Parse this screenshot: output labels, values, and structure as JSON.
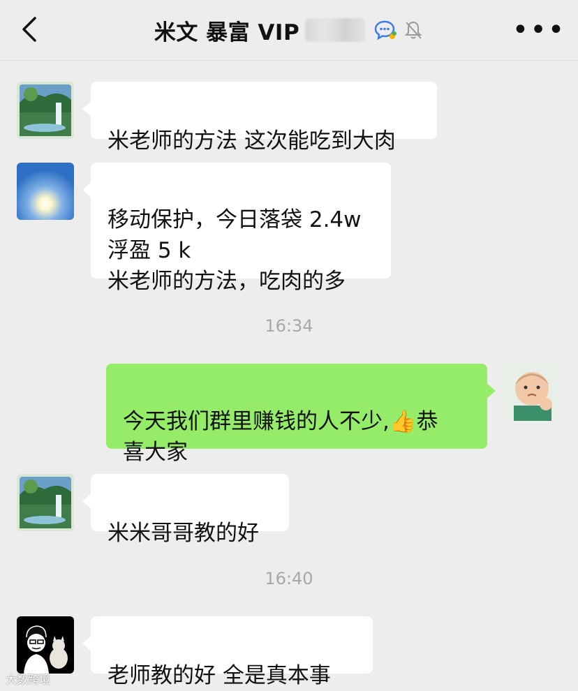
{
  "header": {
    "title": "米文 暴富 VIP",
    "back_icon": "chevron-left-icon",
    "chat_icon": "chat-bubble-icon",
    "mute_icon": "bell-off-icon",
    "more_label": "•••"
  },
  "messages": [
    {
      "side": "left",
      "avatar": "landscape-waterfall",
      "text": "米老师的方法 这次能吃到大肉"
    },
    {
      "side": "left",
      "avatar": "sky-sun",
      "text": "移动保护，今日落袋 2.4w\n浮盈 5 k\n米老师的方法，吃肉的多"
    },
    {
      "side": "right",
      "avatar": "baby-fist",
      "text_before": "今天我们群里赚钱的人不少,",
      "emoji": "👍",
      "text_after": "恭\n喜大家"
    },
    {
      "side": "left",
      "avatar": "landscape-waterfall",
      "text": "米米哥哥教的好"
    },
    {
      "side": "left",
      "avatar": "cartoon-man-cat",
      "text": "老师教的好  全是真本事"
    }
  ],
  "timestamps": [
    "16:34",
    "16:40"
  ],
  "watermark": "大数跨境",
  "colors": {
    "background": "#ededed",
    "bubble_left": "#ffffff",
    "bubble_right": "#95ec69",
    "timestamp": "#a8a8a8"
  }
}
